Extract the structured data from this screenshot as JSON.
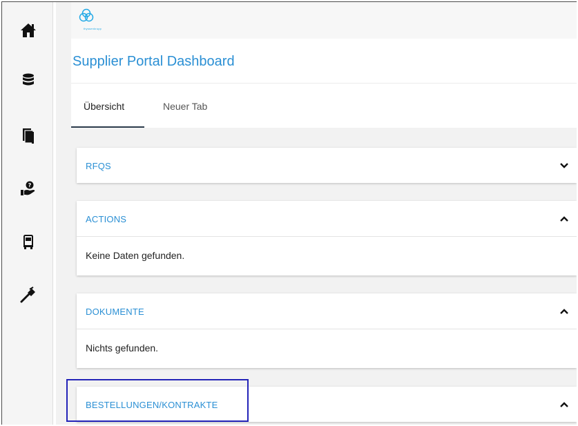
{
  "header": {
    "logo_text": "thyssenkrupp",
    "title": "Supplier Portal Dashboard"
  },
  "tabs": [
    {
      "label": "Übersicht",
      "active": true
    },
    {
      "label": "Neuer Tab",
      "active": false
    }
  ],
  "sidebar": {
    "items": [
      {
        "icon": "home-icon"
      },
      {
        "icon": "database-icon"
      },
      {
        "icon": "documents-icon"
      },
      {
        "icon": "hand-question-icon"
      },
      {
        "icon": "truck-icon"
      },
      {
        "icon": "caliper-icon"
      }
    ]
  },
  "panels": [
    {
      "title": "RFQS",
      "expanded": false,
      "body": null
    },
    {
      "title": "ACTIONS",
      "expanded": true,
      "body": "Keine Daten gefunden."
    },
    {
      "title": "DOKUMENTE",
      "expanded": true,
      "body": "Nichts gefunden."
    },
    {
      "title": "BESTELLUNGEN/KONTRAKTE",
      "expanded": true,
      "body": null
    }
  ],
  "colors": {
    "accent": "#2a8fd4",
    "highlight_border": "#2323b8",
    "logo": "#23a9e6"
  }
}
